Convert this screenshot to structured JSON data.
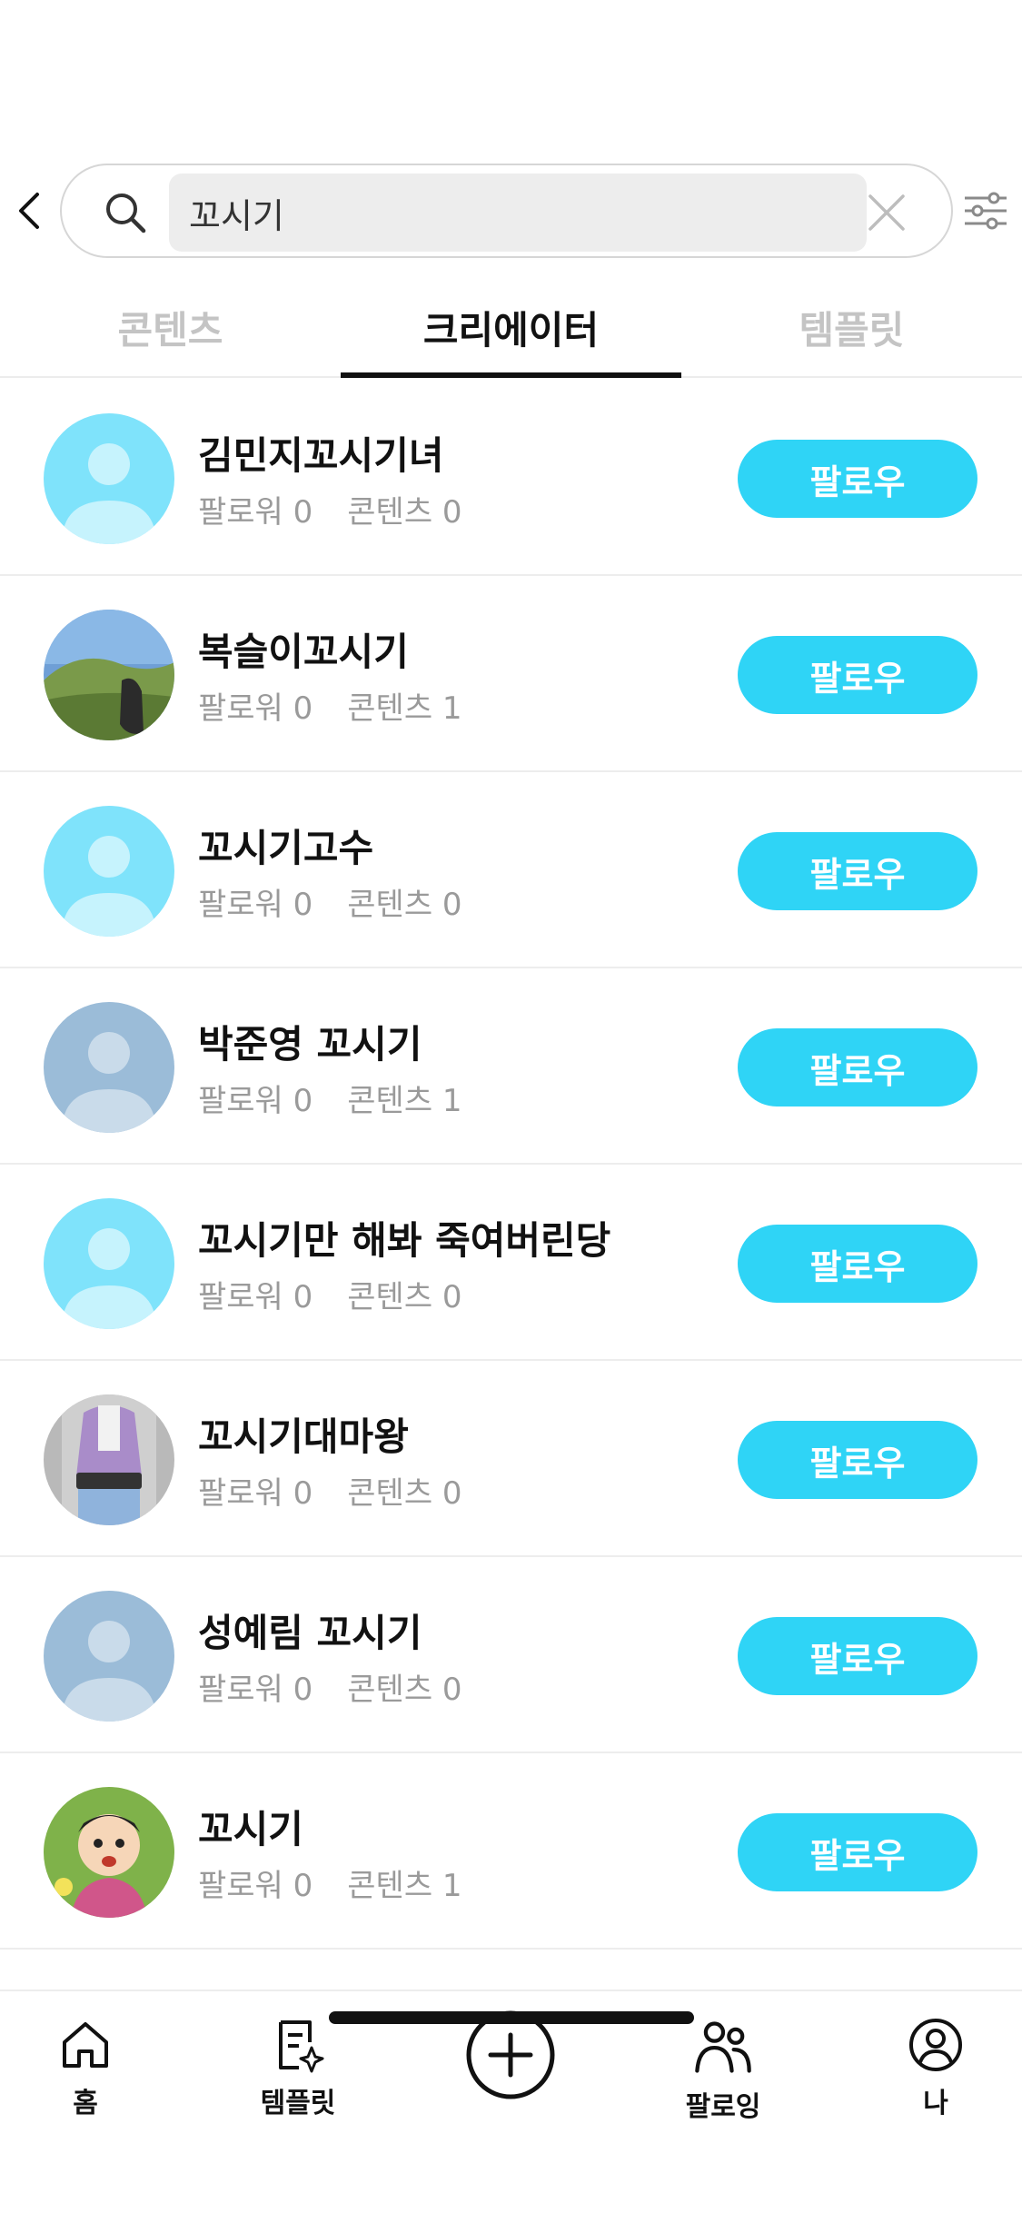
{
  "search": {
    "query": "꼬시기"
  },
  "tabs": [
    {
      "label": "콘텐츠",
      "active": false
    },
    {
      "label": "크리에이터",
      "active": true
    },
    {
      "label": "템플릿",
      "active": false
    }
  ],
  "creators": [
    {
      "name": "김민지꼬시기녀",
      "followers": "팔로워 0",
      "contents": "콘텐츠 0",
      "follow_label": "팔로우",
      "avatar": "default-avatar-cyan"
    },
    {
      "name": "복슬이꼬시기",
      "followers": "팔로워 0",
      "contents": "콘텐츠 1",
      "follow_label": "팔로우",
      "avatar": "landscape-photo"
    },
    {
      "name": "꼬시기고수",
      "followers": "팔로워 0",
      "contents": "콘텐츠 0",
      "follow_label": "팔로우",
      "avatar": "default-avatar-cyan"
    },
    {
      "name": "박준영 꼬시기",
      "followers": "팔로워 0",
      "contents": "콘텐츠 1",
      "follow_label": "팔로우",
      "avatar": "default-avatar-blue"
    },
    {
      "name": "꼬시기만 해봐 죽여버린당",
      "followers": "팔로워 0",
      "contents": "콘텐츠 0",
      "follow_label": "팔로우",
      "avatar": "default-avatar-cyan"
    },
    {
      "name": "꼬시기대마왕",
      "followers": "팔로워 0",
      "contents": "콘텐츠 0",
      "follow_label": "팔로우",
      "avatar": "person-photo"
    },
    {
      "name": "성예림 꼬시기",
      "followers": "팔로워 0",
      "contents": "콘텐츠 0",
      "follow_label": "팔로우",
      "avatar": "default-avatar-blue"
    },
    {
      "name": "꼬시기",
      "followers": "팔로워 0",
      "contents": "콘텐츠 1",
      "follow_label": "팔로우",
      "avatar": "cartoon-photo"
    }
  ],
  "bottom_nav": {
    "home": "홈",
    "template": "템플릿",
    "following": "팔로잉",
    "me": "나"
  },
  "colors": {
    "accent": "#2fd4f6",
    "avatar_cyan": "#7fe3fb",
    "avatar_blue": "#9bbcd8"
  }
}
